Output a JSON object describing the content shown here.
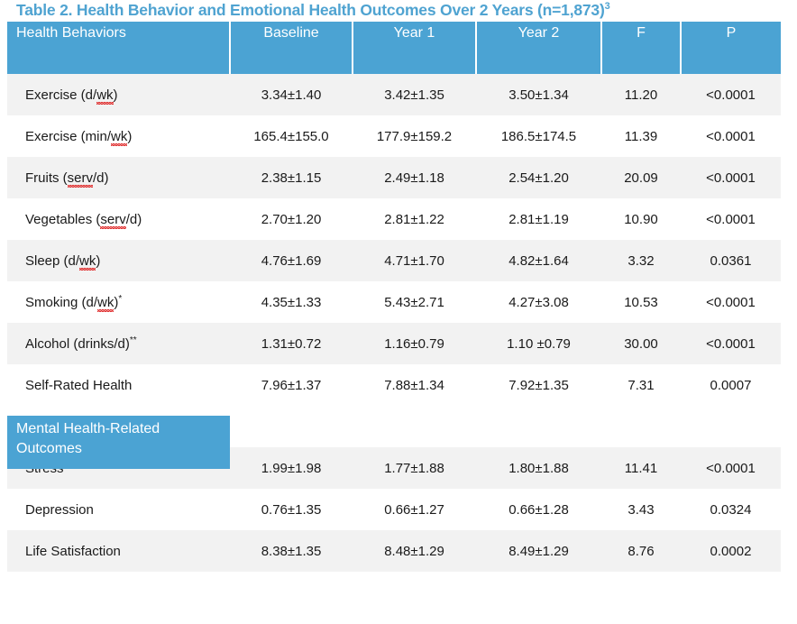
{
  "title": {
    "text": "Table 2. Health Behavior and Emotional Health Outcomes Over 2 Years (n=1,873)",
    "superscript": "3",
    "color": "#4FA3D1"
  },
  "colors": {
    "header_blue": "#4BA3D3",
    "row_shaded": "#F2F2F2",
    "row_plain": "#FFFFFF",
    "text": "#1A1A1A",
    "spellcheck_underline": "#E03030"
  },
  "table": {
    "columns": [
      {
        "key": "label",
        "header": "Health Behaviors"
      },
      {
        "key": "baseline",
        "header": "Baseline"
      },
      {
        "key": "year1",
        "header": "Year 1"
      },
      {
        "key": "year2",
        "header": "Year 2"
      },
      {
        "key": "f",
        "header": "F"
      },
      {
        "key": "p",
        "header": "P"
      }
    ],
    "rows": [
      {
        "label_pre": "Exercise (d/",
        "label_sq": "wk",
        "label_post": ")",
        "label_sup": "",
        "label_full": "Exercise (d/wk)",
        "baseline": "3.34±1.40",
        "year1": "3.42±1.35",
        "year2": "3.50±1.34",
        "f": "11.20",
        "p": "<0.0001",
        "shaded": true
      },
      {
        "label_pre": "Exercise (min/",
        "label_sq": "wk",
        "label_post": ")",
        "label_sup": "",
        "label_full": "Exercise (min/wk)",
        "baseline": "165.4±155.0",
        "year1": "177.9±159.2",
        "year2": "186.5±174.5",
        "f": "11.39",
        "p": "<0.0001",
        "shaded": false
      },
      {
        "label_pre": "Fruits (",
        "label_sq": "serv",
        "label_post": "/d)",
        "label_sup": "",
        "label_full": "Fruits (serv/d)",
        "baseline": "2.38±1.15",
        "year1": "2.49±1.18",
        "year2": "2.54±1.20",
        "f": "20.09",
        "p": "<0.0001",
        "shaded": true
      },
      {
        "label_pre": "Vegetables (",
        "label_sq": "serv",
        "label_post": "/d)",
        "label_sup": "",
        "label_full": "Vegetables (serv/d)",
        "baseline": "2.70±1.20",
        "year1": "2.81±1.22",
        "year2": "2.81±1.19",
        "f": "10.90",
        "p": "<0.0001",
        "shaded": false
      },
      {
        "label_pre": "Sleep (d/",
        "label_sq": "wk",
        "label_post": ")",
        "label_sup": "",
        "label_full": "Sleep (d/wk)",
        "baseline": "4.76±1.69",
        "year1": "4.71±1.70",
        "year2": "4.82±1.64",
        "f": "3.32",
        "p": "0.0361",
        "shaded": true
      },
      {
        "label_pre": "Smoking (d/",
        "label_sq": "wk",
        "label_post": ")",
        "label_sup": "*",
        "label_full": "Smoking (d/wk)*",
        "baseline": "4.35±1.33",
        "year1": "5.43±2.71",
        "year2": "4.27±3.08",
        "f": "10.53",
        "p": "<0.0001",
        "shaded": false
      },
      {
        "label_pre": "Alcohol (drinks/d)",
        "label_sq": "",
        "label_post": "",
        "label_sup": "**",
        "label_full": "Alcohol (drinks/d)**",
        "baseline": "1.31±0.72",
        "year1": "1.16±0.79",
        "year2": "1.10 ±0.79",
        "f": "30.00",
        "p": "<0.0001",
        "shaded": true
      },
      {
        "label_pre": "Self-Rated Health",
        "label_sq": "",
        "label_post": "",
        "label_sup": "",
        "label_full": "Self-Rated Health",
        "baseline": "7.96±1.37",
        "year1": "7.88±1.34",
        "year2": "7.92±1.35",
        "f": "7.31",
        "p": "0.0007",
        "shaded": false
      },
      {
        "label_pre": "",
        "label_sq": "",
        "label_post": "",
        "label_sup": "",
        "label_full": "",
        "baseline": "",
        "year1": "",
        "year2": "",
        "f": "",
        "p": "",
        "shaded": false
      },
      {
        "label_pre": "Stress",
        "label_sq": "",
        "label_post": "",
        "label_sup": "",
        "label_full": "Stress",
        "baseline": "1.99±1.98",
        "year1": "1.77±1.88",
        "year2": "1.80±1.88",
        "f": "11.41",
        "p": "<0.0001",
        "shaded": true
      },
      {
        "label_pre": "Depression",
        "label_sq": "",
        "label_post": "",
        "label_sup": "",
        "label_full": "Depression",
        "baseline": "0.76±1.35",
        "year1": "0.66±1.27",
        "year2": "0.66±1.28",
        "f": "3.43",
        "p": "0.0324",
        "shaded": false
      },
      {
        "label_pre": "Life Satisfaction",
        "label_sq": "",
        "label_post": "",
        "label_sup": "",
        "label_full": "Life Satisfaction",
        "baseline": "8.38±1.35",
        "year1": "8.48±1.29",
        "year2": "8.49±1.29",
        "f": "8.76",
        "p": "0.0002",
        "shaded": true
      }
    ],
    "section_banner": {
      "line1": "Mental Health-Related",
      "line2": "Outcomes"
    }
  }
}
